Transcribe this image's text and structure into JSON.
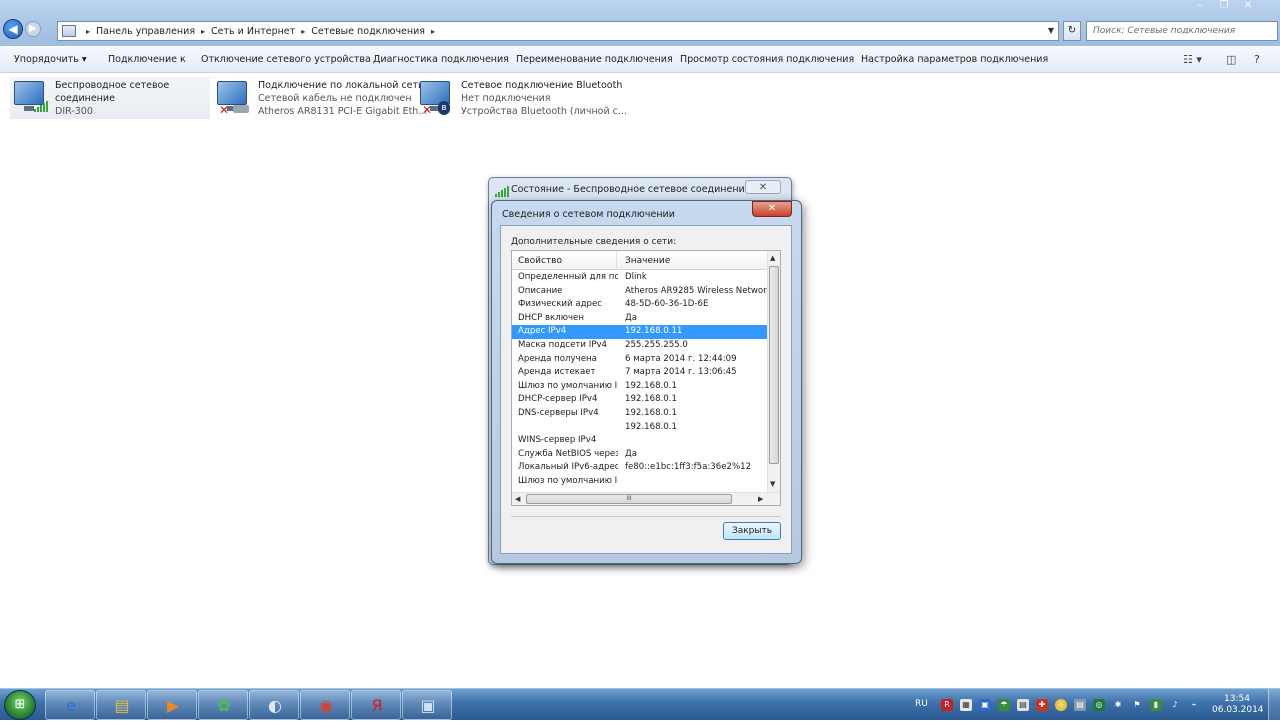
{
  "explorer": {
    "breadcrumbs": [
      "Панель управления",
      "Сеть и Интернет",
      "Сетевые подключения"
    ],
    "search_placeholder": "Поиск: Сетевые подключения",
    "toolbar": [
      "Упорядочить ▾",
      "Подключение к",
      "Отключение сетевого устройства",
      "Диагностика подключения",
      "Переименование подключения",
      "Просмотр состояния подключения",
      "Настройка параметров подключения"
    ],
    "window_controls": [
      "–",
      "❐",
      "✕"
    ],
    "connections": [
      {
        "name_line1": "Беспроводное сетевое",
        "name_line2": "соединение",
        "sub": "DIR-300",
        "icon": "wireless-monitor-icon"
      },
      {
        "name_line1": "Подключение по локальной сети",
        "line2": "Сетевой кабель не подключен",
        "line3": "Atheros AR8131 PCI-E Gigabit Eth...",
        "icon": "ethernet-monitor-icon"
      },
      {
        "name_line1": "Сетевое подключение Bluetooth",
        "line2": "Нет подключения",
        "line3": "Устройства Bluetooth (личной с...",
        "icon": "bluetooth-monitor-icon"
      }
    ]
  },
  "status_dialog": {
    "title": "Состояние - Беспроводное сетевое соединение",
    "close": "✕"
  },
  "details_dialog": {
    "title": "Сведения о сетевом подключении",
    "close": "✕",
    "label": "Дополнительные сведения о сети:",
    "columns": [
      "Свойство",
      "Значение"
    ],
    "selected_index": 4,
    "rows": [
      {
        "k": "Определенный для по...",
        "v": "Dlink"
      },
      {
        "k": "Описание",
        "v": "Atheros AR9285 Wireless Network Ac"
      },
      {
        "k": "Физический адрес",
        "v": "48-5D-60-36-1D-6E"
      },
      {
        "k": "DHCP включен",
        "v": "Да"
      },
      {
        "k": "Адрес IPv4",
        "v": "192.168.0.11"
      },
      {
        "k": "Маска подсети IPv4",
        "v": "255.255.255.0"
      },
      {
        "k": "Аренда получена",
        "v": "6 марта 2014 г. 12:44:09"
      },
      {
        "k": "Аренда истекает",
        "v": "7 марта 2014 г. 13:06:45"
      },
      {
        "k": "Шлюз по умолчанию IP...",
        "v": "192.168.0.1"
      },
      {
        "k": "DHCP-сервер IPv4",
        "v": "192.168.0.1"
      },
      {
        "k": "DNS-серверы IPv4",
        "v": "192.168.0.1"
      },
      {
        "k": "",
        "v": "192.168.0.1"
      },
      {
        "k": "WINS-сервер IPv4",
        "v": ""
      },
      {
        "k": "Служба NetBIOS через...",
        "v": "Да"
      },
      {
        "k": "Локальный IPv6-адрес...",
        "v": "fe80::e1bc:1ff3:f5a:36e2%12"
      },
      {
        "k": "Шлюз по умолчанию IP...",
        "v": ""
      }
    ],
    "hscroll_grip": "III",
    "close_button": "Закрыть"
  },
  "taskbar": {
    "start_icon": "windows-start-icon",
    "apps": [
      {
        "name": "internet-explorer-icon",
        "glyph": "e",
        "color": "#1e74d6"
      },
      {
        "name": "windows-explorer-icon",
        "glyph": "▤",
        "color": "#e6b840"
      },
      {
        "name": "media-player-icon",
        "glyph": "▶",
        "color": "#e8862a"
      },
      {
        "name": "icq-icon",
        "glyph": "✿",
        "color": "#46c43a"
      },
      {
        "name": "audio-app-icon",
        "glyph": "◐",
        "color": "#e0e6ee"
      },
      {
        "name": "chrome-icon",
        "glyph": "◉",
        "color": "#d8402e"
      },
      {
        "name": "yandex-browser-icon",
        "glyph": "Я",
        "color": "#d81a1a"
      },
      {
        "name": "network-connections-icon",
        "glyph": "▣",
        "color": "#cfe0f2"
      }
    ],
    "language": "RU",
    "time": "13:54",
    "date": "06.03.2014"
  },
  "colors": {
    "selection": "#3399ff",
    "taskbar": "#3e71aa",
    "titlebar": "#a9c5e6"
  }
}
